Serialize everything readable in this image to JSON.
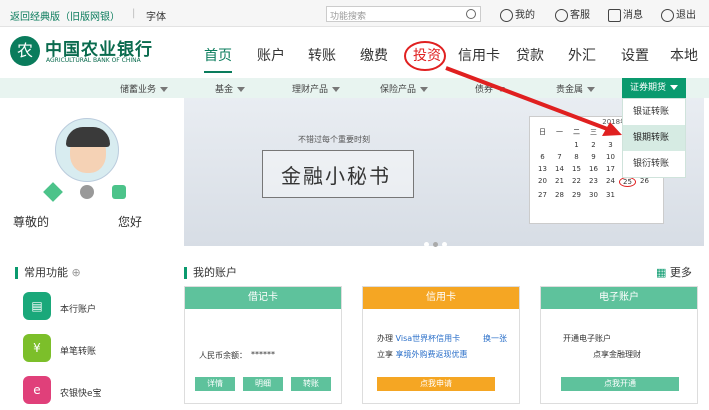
{
  "topbar": {
    "back_label": "返回经典版（旧版网银）",
    "font_label": "字体",
    "search_placeholder": "功能搜索",
    "my_label": "我的",
    "service_label": "客服",
    "msg_label": "消息",
    "msg_count": "1",
    "logout_label": "退出"
  },
  "brand": {
    "name_cn": "中国农业银行",
    "name_en": "AGRICULTURAL BANK OF CHINA",
    "logo_char": "农"
  },
  "nav": [
    "首页",
    "账户",
    "转账",
    "缴费",
    "投资",
    "信用卡",
    "贷款",
    "外汇",
    "设置",
    "本地"
  ],
  "subnav": [
    "储蓄业务",
    "基金",
    "理财产品",
    "保险产品",
    "债券",
    "贵金属",
    "证券期货"
  ],
  "dropdown": [
    "银证转账",
    "银期转账",
    "银衍转账"
  ],
  "banner": {
    "tagline": "不错过每个重要时刻",
    "title": "金融小秘书",
    "cal_month": "2018年05月",
    "cal_head": [
      "日",
      "一",
      "二",
      "三",
      "四",
      "五",
      "六"
    ],
    "cal_days": [
      "",
      "",
      "1",
      "2",
      "3",
      "4",
      "5",
      "6",
      "7",
      "8",
      "9",
      "10",
      "11",
      "12",
      "13",
      "14",
      "15",
      "16",
      "17",
      "18",
      "19",
      "20",
      "21",
      "22",
      "23",
      "24",
      "25",
      "26",
      "27",
      "28",
      "29",
      "30",
      "31",
      "",
      ""
    ]
  },
  "profile": {
    "greet1": "尊敬的",
    "greet2": "您好"
  },
  "common": {
    "title": "常用功能",
    "items": [
      "本行账户",
      "单笔转账",
      "农银快e宝"
    ]
  },
  "accounts": {
    "title": "我的账户",
    "more": "更多",
    "debit": {
      "title": "借记卡",
      "bal_label": "人民币余额：",
      "bal": "******",
      "btns": [
        "详情",
        "明细",
        "转账"
      ]
    },
    "credit": {
      "title": "信用卡",
      "line1": "办理",
      "line1b": "Visa世界杯信用卡",
      "line2": "立享",
      "line2b": "享境外购费返现优惠",
      "link": "换一张",
      "btn": "点我申请"
    },
    "e": {
      "title": "电子账户",
      "line1": "开通电子账户",
      "line2": "点享金融理财",
      "btn": "点我开通"
    }
  },
  "colors": {
    "green": "#0a9a6e",
    "orange": "#f5a623",
    "red": "#e02020"
  }
}
